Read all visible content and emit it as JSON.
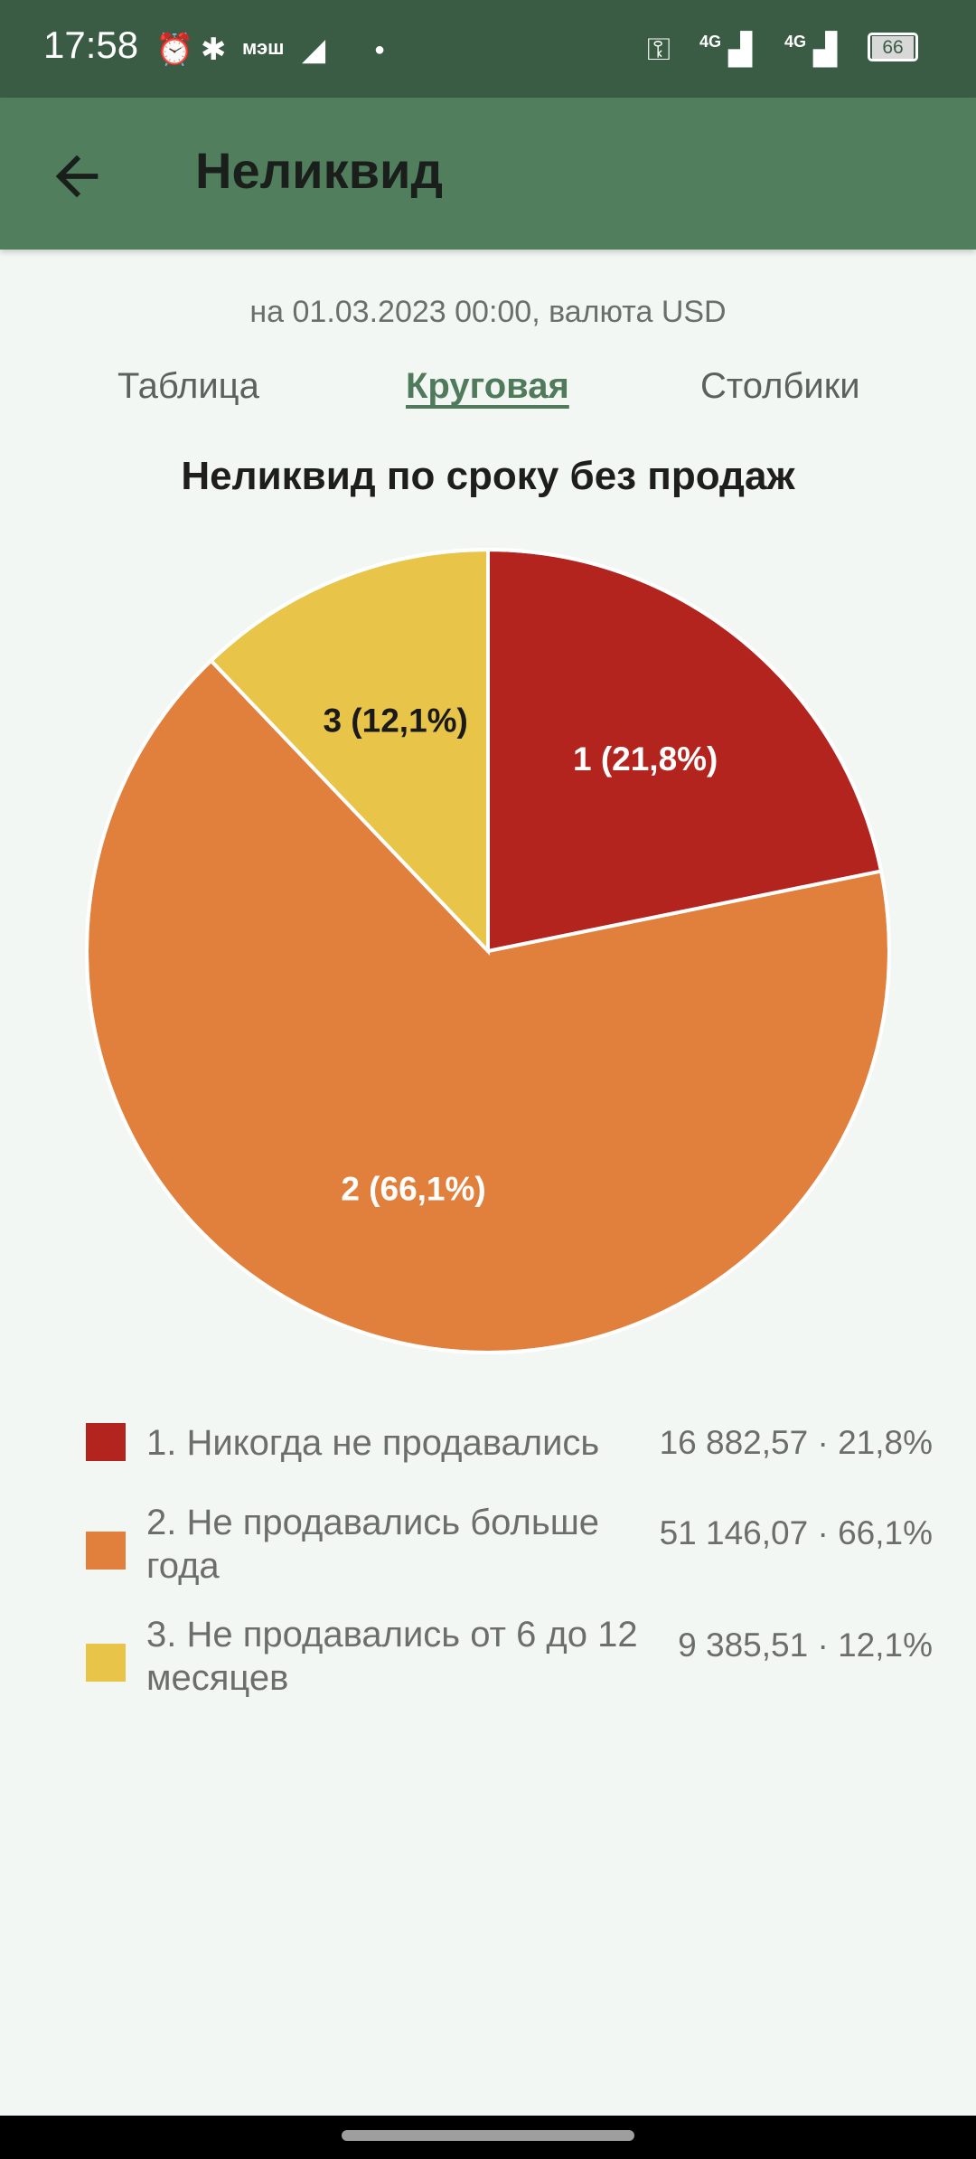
{
  "status_bar": {
    "time": "17:58",
    "carrier": "мэш",
    "network_1": "4G",
    "network_2": "4G",
    "battery": "66"
  },
  "app_bar": {
    "title": "Неликвид",
    "back_icon": "arrow-left-icon"
  },
  "subtitle": "на 01.03.2023 00:00, валюта USD",
  "tabs": [
    {
      "label": "Таблица",
      "active": false
    },
    {
      "label": "Круговая",
      "active": true
    },
    {
      "label": "Столбики",
      "active": false
    }
  ],
  "chart_data": {
    "type": "pie",
    "title": "Неликвид по сроку без продаж",
    "slices": [
      {
        "index": "1",
        "label": "1. Никогда не продавались",
        "value": 16882.57,
        "value_text": "16 882,57",
        "percent": 21.8,
        "percent_text": "21,8%",
        "slice_label": "1 (21,8%)",
        "color": "#b3241f",
        "label_color": "#ffffff"
      },
      {
        "index": "2",
        "label": "2. Не продавались больше года",
        "value": 51146.07,
        "value_text": "51 146,07",
        "percent": 66.1,
        "percent_text": "66,1%",
        "slice_label": "2 (66,1%)",
        "color": "#e1803c",
        "label_color": "#ffffff"
      },
      {
        "index": "3",
        "label": "3. Не продавались от 6 до 12 месяцев",
        "value": 9385.51,
        "value_text": "9 385,51",
        "percent": 12.1,
        "percent_text": "12,1%",
        "slice_label": "3 (12,1%)",
        "color": "#e8c548",
        "label_color": "#1a1a1a"
      }
    ]
  }
}
